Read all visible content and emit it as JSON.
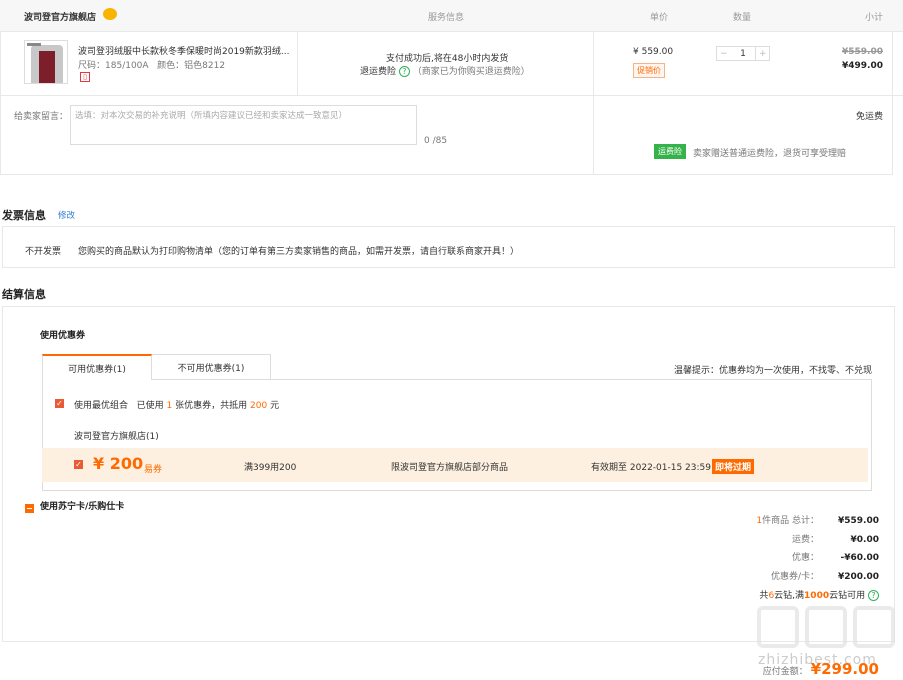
{
  "order": {
    "headers": {
      "shop": "波司登官方旗舰店",
      "service": "服务信息",
      "price": "单价",
      "qty": "数量",
      "subtotal": "小计"
    },
    "product": {
      "title": "波司登羽绒服中长款秋冬季保暖时尚2019新款羽绒...",
      "size_label": "尺码：",
      "size": "185/100A",
      "color_label": "颜色：",
      "color": "铝色8212"
    },
    "service": {
      "delivery": "支付成功后,将在48小时内发货",
      "insurance": "退运费险",
      "insurance_note": "（商家已为你购买退运费险）"
    },
    "price": "¥ 559.00",
    "price_tag": "促销价",
    "qty": "1",
    "qty_minus": "−",
    "qty_plus": "+",
    "orig_subtotal": "¥559.00",
    "subtotal": "¥499.00",
    "message_label": "给卖家留言：",
    "message_placeholder": "选填：对本次交易的补充说明（所填内容建议已经和卖家达成一致意见）",
    "message_count": "0 /85",
    "shipping_free": "免运费",
    "insurance_tag": "运费险",
    "insurance_desc": "卖家赠送普通运费险，退货可享受理赔"
  },
  "invoice": {
    "title": "发票信息",
    "edit": "修改",
    "type": "不开发票",
    "desc": "您购买的商品默认为打印购物清单（您的订单有第三方卖家销售的商品，如需开发票，请自行联系商家开具！）"
  },
  "settle": {
    "title": "结算信息",
    "coupon_section": "使用优惠券",
    "tabs": [
      "可用优惠券(1)",
      "不可用优惠券(1)"
    ],
    "tip": "温馨提示：优惠券均为一次使用，不找零、不兑现",
    "best_combo": "使用最优组合",
    "used_prefix": "已使用",
    "used_count": "1",
    "used_mid": "张优惠券，共抵用",
    "used_amount": "200",
    "used_suffix": "元",
    "store_name": "波司登官方旗舰店(1)",
    "coupon": {
      "amount": "¥ 200",
      "type": "易券",
      "rule": "满399用200",
      "scope": "限波司登官方旗舰店部分商品",
      "expiry_label": "有效期至",
      "expiry": "2022-01-15 23:59",
      "expiring": "即将过期"
    },
    "card_section": "使用苏宁卡/乐购仕卡"
  },
  "summary": {
    "items_count": "1",
    "items_label": "件商品 总计：",
    "items_total": "¥559.00",
    "shipping_label": "运费：",
    "shipping": "¥0.00",
    "discount_label": "优惠：",
    "discount": "-¥60.00",
    "coupon_label": "优惠券/卡：",
    "coupon": "¥200.00",
    "cloud_prefix": "共",
    "cloud_count": "6",
    "cloud_mid": "云钻,满",
    "cloud_threshold": "1000",
    "cloud_suffix": "云钻可用",
    "payable_label": "应付金额：",
    "payable": "¥299.00"
  },
  "watermark": "zhizhibest.com",
  "colors": {
    "accent": "#ff6a00",
    "green": "#35b34a",
    "link": "#2f7ad3"
  }
}
